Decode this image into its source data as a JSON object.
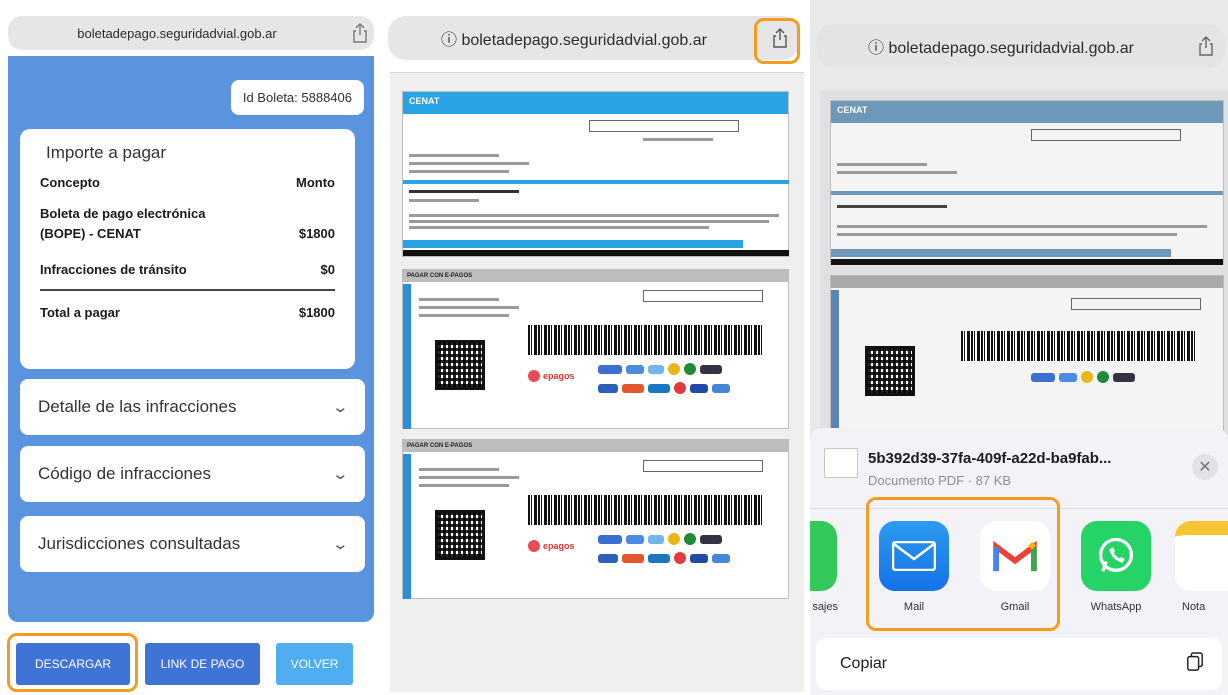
{
  "panel1": {
    "url": "boletadepago.seguridadvial.gob.ar",
    "id_boleta": "Id Boleta: 5888406",
    "importe": {
      "title": "Importe a pagar",
      "col_concepto": "Concepto",
      "col_monto": "Monto",
      "item1_line1": "Boleta de pago electrónica",
      "item1_line2": "(BOPE) - CENAT",
      "item1_amount": "$1800",
      "item2_label": "Infracciones de tránsito",
      "item2_amount": "$0",
      "total_label": "Total a pagar",
      "total_amount": "$1800"
    },
    "accordions": [
      "Detalle de las infracciones",
      "Código de infracciones",
      "Jurisdicciones consultadas"
    ],
    "buttons": {
      "descargar": "DESCARGAR",
      "link": "LINK DE PAGO",
      "volver": "VOLVER"
    }
  },
  "panel2": {
    "url": "boletadepago.seguridadvial.gob.ar",
    "cenat": "CENAT",
    "coupon_header": "PAGAR CON E-PAGOS",
    "epagos": "epagos"
  },
  "panel3": {
    "url": "boletadepago.seguridadvial.gob.ar",
    "cenat": "CENAT",
    "file_name": "5b392d39-37fa-409f-a22d-ba9fab...",
    "file_sub": "Documento PDF · 87 KB",
    "apps": [
      "sajes",
      "Mail",
      "Gmail",
      "WhatsApp",
      "Nota"
    ],
    "copy": "Copiar"
  },
  "colors": {
    "accent_orange": "#f39c20",
    "card_blue": "#5a93de",
    "button_blue": "#3f74d6",
    "button_light_blue": "#4faef0"
  }
}
